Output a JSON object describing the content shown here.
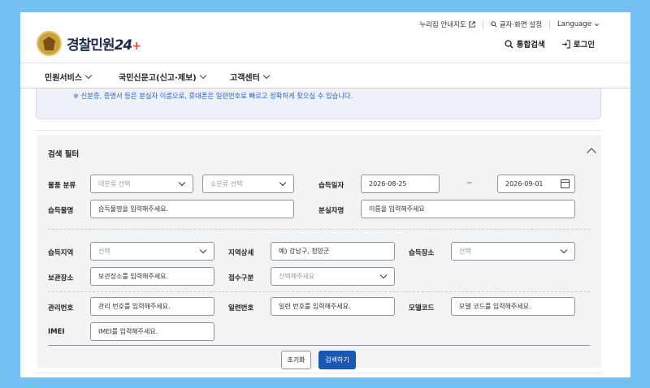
{
  "header": {
    "util_links": [
      {
        "label": "누리집 안내지도",
        "icon": "external-link-icon"
      },
      {
        "label": "글자·화면 설정",
        "icon": "zoom-icon"
      },
      {
        "label": "Language",
        "icon": "chevron-down-icon"
      }
    ],
    "logo_text": "경찰민원",
    "logo_num": "24",
    "logo_plus": "+",
    "search_label": "통합검색",
    "login_label": "로그인"
  },
  "nav": [
    {
      "label": "민원서비스",
      "active": true
    },
    {
      "label": "국민신문고(신고·제보)",
      "active": false
    },
    {
      "label": "고객센터",
      "active": false
    }
  ],
  "notice": "※ 신분증, 증명서 등은 분실자 이름으로, 휴대폰은 일련번호로 빠르고 정확하게 찾으실 수 있습니다.",
  "filter": {
    "title": "검색 필터",
    "category_label": "물품 분류",
    "category_main_placeholder": "대분류 선택",
    "category_sub_placeholder": "소분류 선택",
    "date_label": "습득일자",
    "date_from": "2026-08-25",
    "date_sep": "~",
    "date_to": "2026-09-01",
    "item_name_label": "습득물명",
    "item_name_placeholder": "습득물명을 입력해주세요.",
    "owner_label": "분실자명",
    "owner_placeholder": "이름을 입력해주세요",
    "region_label": "습득지역",
    "region_placeholder": "선택",
    "region_detail_label": "지역상세",
    "region_detail_placeholder": "예) 강남구, 청양군",
    "place_label": "습득장소",
    "place_placeholder": "선택",
    "storage_label": "보관장소",
    "storage_placeholder": "보관장소를 입력해주세요.",
    "receipt_label": "접수구분",
    "receipt_placeholder": "선택해주세요",
    "mgmt_label": "관리번호",
    "mgmt_placeholder": "관리 번호를 입력해주세요.",
    "serial_label": "일련번호",
    "serial_placeholder": "일련 번호를 입력해주세요.",
    "model_label": "모델코드",
    "model_placeholder": "모델 코드를 입력해주세요.",
    "imei_label": "IMEI",
    "imei_placeholder": "IMEI를 입력해주세요.",
    "reset_label": "초기화",
    "search_label": "검색하기"
  },
  "colors": {
    "primary": "#1a56b4",
    "background": "#74c0f5",
    "notice_text": "#2b5fc0"
  }
}
